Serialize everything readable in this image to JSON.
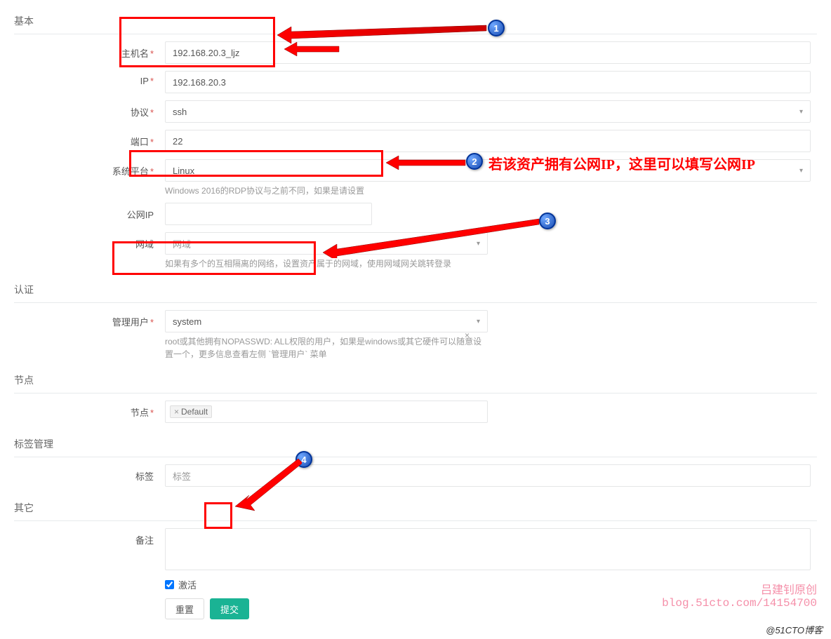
{
  "sections": {
    "basic": "基本",
    "auth": "认证",
    "node": "节点",
    "tag_mgmt": "标签管理",
    "other": "其它"
  },
  "labels": {
    "hostname": "主机名",
    "ip": "IP",
    "protocol": "协议",
    "port": "端口",
    "platform": "系统平台",
    "public_ip": "公网IP",
    "domain": "网域",
    "admin_user": "管理用户",
    "node": "节点",
    "tag": "标签",
    "remark": "备注"
  },
  "values": {
    "hostname": "192.168.20.3_ljz",
    "ip": "192.168.20.3",
    "protocol": "ssh",
    "port": "22",
    "platform": "Linux",
    "public_ip": "",
    "domain": "网域",
    "admin_user": "system",
    "node_tag": "Default",
    "tag_placeholder": "标签",
    "remark": "",
    "active_checked": true
  },
  "helpers": {
    "platform": "Windows 2016的RDP协议与之前不同，如果是请设置",
    "domain": "如果有多个的互相隔离的网络，设置资产属于的网域，使用网域网关跳转登录",
    "admin_user": "root或其他拥有NOPASSWD: ALL权限的用户，如果是windows或其它硬件可以随意设置一个，更多信息查看左侧 `管理用户` 菜单"
  },
  "checkbox": {
    "active": "激活"
  },
  "buttons": {
    "reset": "重置",
    "submit": "提交"
  },
  "annotations": {
    "num1": "1",
    "num2": "2",
    "num3": "3",
    "num4": "4",
    "callout2_text": "若该资产拥有公网IP，这里可以填写公网IP"
  },
  "watermark": {
    "line1": "吕建钊原创",
    "line2": "blog.51cto.com/14154700"
  },
  "footer": "@51CTO博客"
}
